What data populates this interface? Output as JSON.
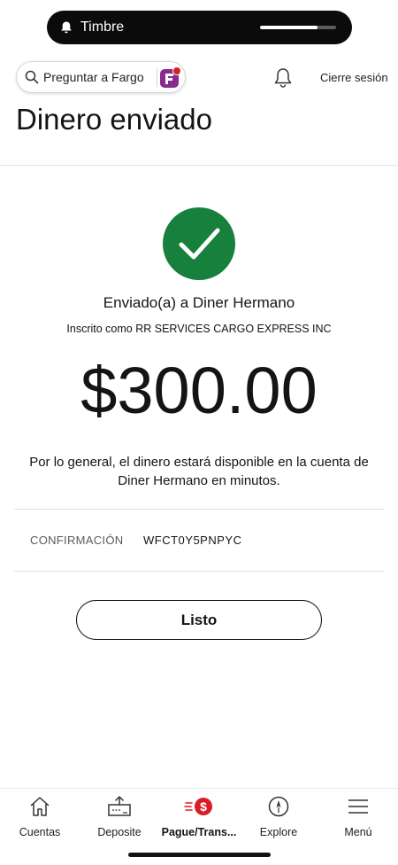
{
  "notification": {
    "label": "Timbre",
    "icon": "bell-icon",
    "progress_fraction": 0.75
  },
  "header": {
    "search_placeholder": "Preguntar a Fargo",
    "search_icon": "search-icon",
    "fargo_icon": "fargo-assistant-icon",
    "alerts_icon": "bell-icon",
    "logout_label": "Cierre sesión",
    "page_title": "Dinero enviado"
  },
  "confirmation": {
    "status_icon": "checkmark-icon",
    "status_color": "#17803d",
    "sent_to": "Enviado(a) a Diner Hermano",
    "enrolled_as": "Inscrito como RR SERVICES CARGO EXPRESS INC",
    "amount": "$300.00",
    "note": "Por lo general, el dinero estará disponible en la cuenta de Diner Hermano en minutos.",
    "confirmation_label": "CONFIRMACIÓN",
    "confirmation_value": "WFCT0Y5PNPYC",
    "done_label": "Listo"
  },
  "bottom_nav": {
    "accent_color": "#d71e28",
    "items": [
      {
        "label": "Cuentas",
        "icon": "home-icon"
      },
      {
        "label": "Deposite",
        "icon": "deposit-check-icon"
      },
      {
        "label": "Pague/Trans...",
        "icon": "pay-transfer-icon",
        "active": true
      },
      {
        "label": "Explore",
        "icon": "compass-icon"
      },
      {
        "label": "Menú",
        "icon": "hamburger-menu-icon"
      }
    ]
  }
}
